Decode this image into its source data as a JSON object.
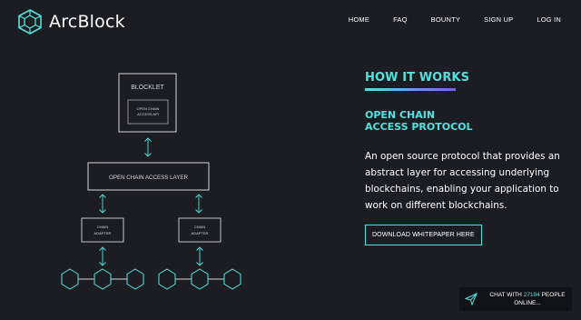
{
  "brand": {
    "name": "ArcBlock",
    "icon": "arcblock-logo-icon"
  },
  "nav": {
    "items": [
      {
        "label": "HOME"
      },
      {
        "label": "FAQ"
      },
      {
        "label": "BOUNTY"
      },
      {
        "label": "SIGN UP"
      },
      {
        "label": "LOG IN"
      }
    ]
  },
  "diagram": {
    "blocklet_label": "BLOCKLET",
    "inner_api_line1": "OPEN CHAIN",
    "inner_api_line2": "ACCESS API",
    "access_layer_label": "OPEN CHAIN ACCESS LAYER",
    "adapter_left_line1": "CHAIN",
    "adapter_left_line2": "ADAPTER",
    "adapter_right_line1": "CHAIN",
    "adapter_right_line2": "ADAPTER"
  },
  "content": {
    "section_title": "HOW IT WORKS",
    "subtitle_line1": "OPEN CHAIN",
    "subtitle_line2": "ACCESS PROTOCOL",
    "description": "An open source protocol that provides an abstract layer for accessing underlying blockchains, enabling your application to work on different blockchains.",
    "download_label": "DOWNLOAD WHITEPAPER HERE"
  },
  "chat": {
    "prefix": "CHAT WITH",
    "count": "27194",
    "suffix": "PEOPLE",
    "line2": "ONLINE...",
    "icon": "send-icon"
  },
  "colors": {
    "accent": "#4fe3e0",
    "accent_secondary": "#7a5cff",
    "background": "#1c1d22"
  }
}
